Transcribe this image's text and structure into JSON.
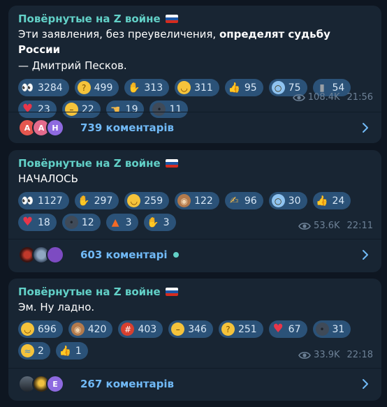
{
  "posts": [
    {
      "channel": "Повёрнутые на Z войне",
      "text_plain": "Эти заявления, без преувеличения, ",
      "text_bold": "определят судьбу России",
      "text_author": "—  Дмитрий Песков.",
      "reactions": [
        {
          "emoji": "eyes",
          "count": "3284"
        },
        {
          "emoji": "thinking",
          "count": "499"
        },
        {
          "emoji": "pray",
          "count": "313"
        },
        {
          "emoji": "grin",
          "count": "311"
        },
        {
          "emoji": "thumbs-up",
          "count": "95"
        },
        {
          "emoji": "scream",
          "count": "75"
        },
        {
          "emoji": "moai",
          "count": "54"
        },
        {
          "emoji": "heart",
          "count": "23"
        },
        {
          "emoji": "neutral",
          "count": "22"
        },
        {
          "emoji": "point-left",
          "count": "19"
        },
        {
          "emoji": "new-moon-face",
          "count": "11"
        }
      ],
      "views": "108.4K",
      "time": "21:56",
      "comments_label": "739 коментарів",
      "avatars": [
        "А",
        "А",
        "Н"
      ],
      "unread_dot": false
    },
    {
      "channel": "Повёрнутые на Z войне",
      "text_plain": "НАЧАЛОСЬ",
      "reactions": [
        {
          "emoji": "eyes",
          "count": "1127"
        },
        {
          "emoji": "pray",
          "count": "297"
        },
        {
          "emoji": "grin",
          "count": "259"
        },
        {
          "emoji": "see-no-evil",
          "count": "122"
        },
        {
          "emoji": "writing-hand",
          "count": "96"
        },
        {
          "emoji": "scream",
          "count": "30"
        },
        {
          "emoji": "thumbs-up",
          "count": "24"
        },
        {
          "emoji": "heart",
          "count": "18"
        },
        {
          "emoji": "new-moon-face",
          "count": "12"
        },
        {
          "emoji": "fire",
          "count": "3"
        },
        {
          "emoji": "clap",
          "count": "3"
        }
      ],
      "views": "53.6K",
      "time": "22:11",
      "comments_label": "603 коментарі",
      "avatars": [
        "",
        "",
        ""
      ],
      "unread_dot": true
    },
    {
      "channel": "Повёрнутые на Z войне",
      "text_plain": "Эм. Ну ладно.",
      "reactions": [
        {
          "emoji": "grin",
          "count": "696"
        },
        {
          "emoji": "see-no-evil",
          "count": "420"
        },
        {
          "emoji": "cursing-face",
          "count": "403"
        },
        {
          "emoji": "neutral",
          "count": "346"
        },
        {
          "emoji": "thinking",
          "count": "251"
        },
        {
          "emoji": "heart",
          "count": "67"
        },
        {
          "emoji": "new-moon-face",
          "count": "31"
        },
        {
          "emoji": "cry",
          "count": "2"
        },
        {
          "emoji": "thumbs-up",
          "count": "1"
        }
      ],
      "views": "33.9K",
      "time": "22:18",
      "comments_label": "267 коментарів",
      "avatars": [
        "",
        "",
        "Е"
      ],
      "unread_dot": false
    }
  ],
  "colors": {
    "background": "#0e1621",
    "bubble": "#182533",
    "channel_name": "#62d0c7",
    "chip": "#2b5278",
    "comment_link": "#71baf7",
    "meta": "#6d8196"
  }
}
